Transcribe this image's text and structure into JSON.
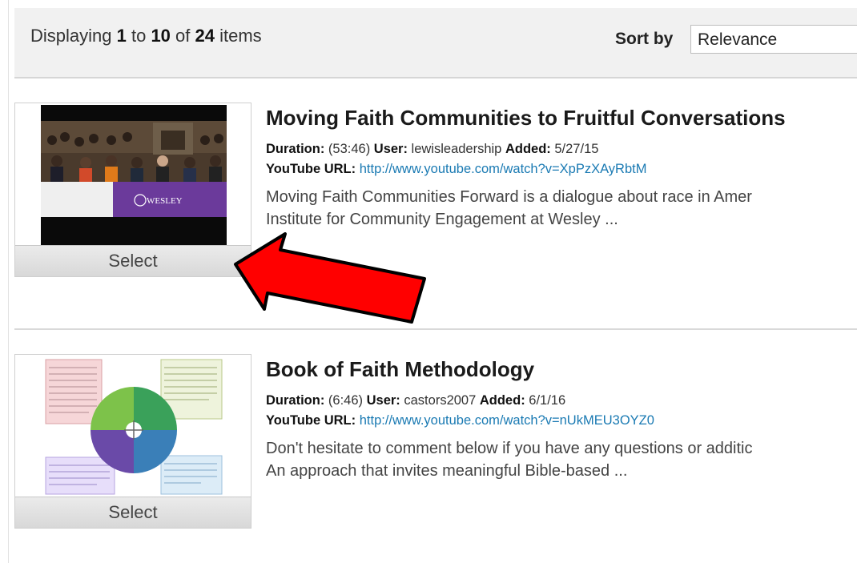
{
  "header": {
    "displaying_prefix": "Displaying ",
    "range_start": "1",
    "to": " to ",
    "range_end": "10",
    "of": " of ",
    "total": "24",
    "suffix": " items",
    "sort_label": "Sort by",
    "sort_value": "Relevance"
  },
  "results": [
    {
      "title": "Moving Faith Communities to Fruitful Conversations",
      "duration_label": "Duration:",
      "duration": " (53:46) ",
      "user_label": "User:",
      "user": " lewisleadership ",
      "added_label": "Added:",
      "added": " 5/27/15",
      "url_label": "YouTube URL:",
      "url": "http://www.youtube.com/watch?v=XpPzXAyRbtM",
      "description_line1": "Moving Faith Communities Forward is a dialogue about race in Amer",
      "description_line2": "Institute for Community Engagement at Wesley ...",
      "select_label": "Select",
      "thumb_banner_text": "WESLEY"
    },
    {
      "title": "Book of Faith Methodology",
      "duration_label": "Duration:",
      "duration": " (6:46) ",
      "user_label": "User:",
      "user": " castors2007 ",
      "added_label": "Added:",
      "added": " 6/1/16",
      "url_label": "YouTube URL:",
      "url": "http://www.youtube.com/watch?v=nUkMEU3OYZ0",
      "description_line1": "Don't hesitate to comment below if you have any questions or additic",
      "description_line2": "An approach that invites meaningful Bible-based ...",
      "select_label": "Select"
    }
  ],
  "colors": {
    "link": "#1a7ab3",
    "arrow_fill": "#ff0000",
    "arrow_stroke": "#000000",
    "banner_purple": "#6b3a9b"
  }
}
